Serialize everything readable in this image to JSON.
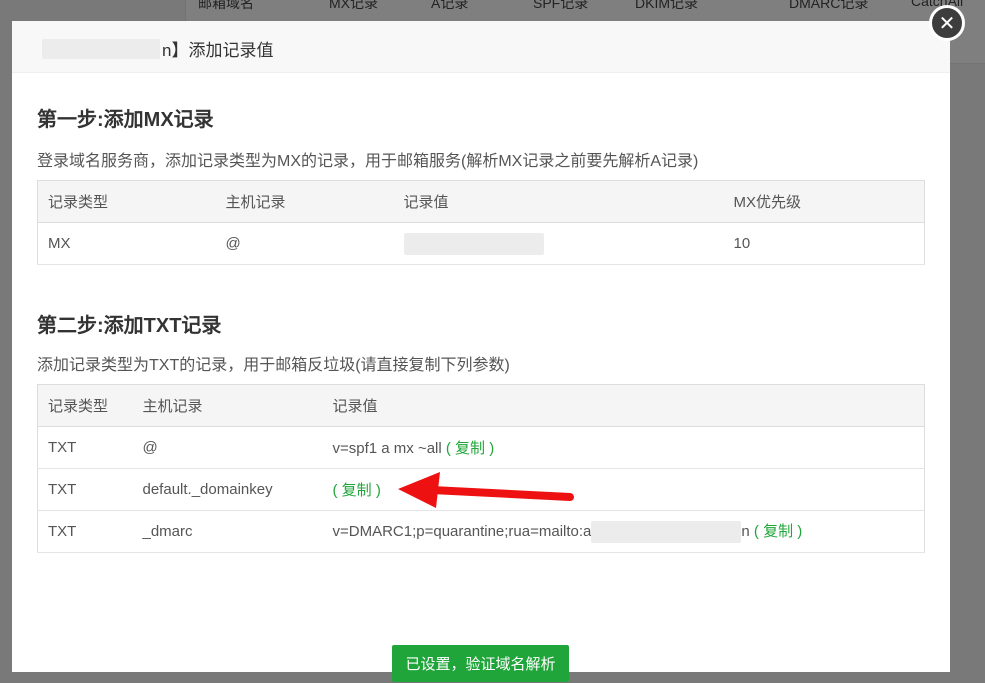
{
  "background": {
    "columns": [
      "邮箱域名",
      "MX记录",
      "A记录",
      "SPF记录",
      "DKIM记录",
      "DMARC记录",
      "CatchAll"
    ]
  },
  "modal": {
    "title_suffix": "n】添加记录值",
    "close_icon": "close-icon"
  },
  "step1": {
    "title": "第一步:添加MX记录",
    "desc": "登录域名服务商，添加记录类型为MX的记录，用于邮箱服务(解析MX记录之前要先解析A记录)",
    "headers": [
      "记录类型",
      "主机记录",
      "记录值",
      "MX优先级"
    ],
    "row": {
      "type": "MX",
      "host": "@",
      "priority": "10"
    }
  },
  "step2": {
    "title": "第二步:添加TXT记录",
    "desc": "添加记录类型为TXT的记录，用于邮箱反垃圾(请直接复制下列参数)",
    "headers": [
      "记录类型",
      "主机记录",
      "记录值"
    ],
    "rows": [
      {
        "type": "TXT",
        "host": "@",
        "value": "v=spf1 a mx ~all",
        "value_suffix": "",
        "copy": "( 复制 )"
      },
      {
        "type": "TXT",
        "host": "default._domainkey",
        "value": "",
        "value_suffix": "",
        "copy": "( 复制 )"
      },
      {
        "type": "TXT",
        "host": "_dmarc",
        "value": "v=DMARC1;p=quarantine;rua=mailto:a",
        "value_suffix": "n",
        "copy": "( 复制 )"
      }
    ]
  },
  "verify_button": "已设置，验证域名解析",
  "colors": {
    "accent": "#20a53a",
    "arrow": "#ee1111"
  }
}
